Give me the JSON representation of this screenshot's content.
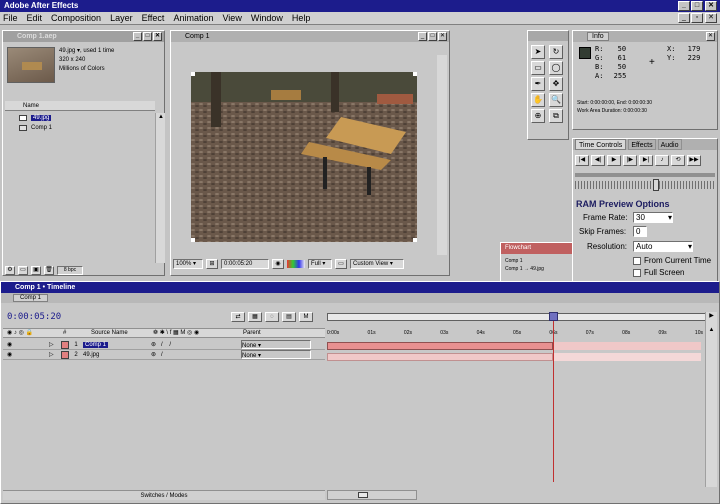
{
  "app": {
    "title": "Adobe After Effects",
    "menu": [
      "File",
      "Edit",
      "Composition",
      "Layer",
      "Effect",
      "Animation",
      "View",
      "Window",
      "Help"
    ]
  },
  "project": {
    "title": "Comp 1.aep",
    "thumb_info": [
      "49.jpg ▾, used 1 time",
      "320 x 240",
      "Millions of Colors"
    ],
    "column_header": "Name",
    "items": [
      {
        "name": "49.jpg",
        "selected": true
      },
      {
        "name": "Comp 1",
        "selected": false
      }
    ],
    "bit_depth": "8 bpc"
  },
  "comp": {
    "tab": "Comp 1",
    "zoom": "100%",
    "timecode": "0:00:05:20",
    "resolution": "Full",
    "view": "Custom View"
  },
  "info": {
    "tab": "Info",
    "r_label": "R:",
    "r": "50",
    "g_label": "G:",
    "g": "61",
    "b_label": "B:",
    "b": "50",
    "a_label": "A:",
    "a": "255",
    "x_label": "X:",
    "x": "179",
    "y_label": "Y:",
    "y": "229",
    "start": "Start: 0:00:00:00, End: 0:00:00:30",
    "work": "Work Area Duration: 0:00:00:30"
  },
  "time_controls": {
    "tabs": [
      "Time Controls",
      "Effects",
      "Audio"
    ],
    "ram_title": "RAM Preview Options",
    "frame_rate_label": "Frame Rate:",
    "frame_rate": "30",
    "skip_label": "Skip Frames:",
    "skip": "0",
    "resolution_label": "Resolution:",
    "resolution": "Auto",
    "from_current": "From Current Time",
    "full_screen": "Full Screen"
  },
  "flowchart": {
    "tab": "Flowchart",
    "items": [
      "Comp 1",
      "Comp 1 → 49.jpg"
    ]
  },
  "timeline": {
    "title": "Comp 1 • Timeline",
    "tab": "Comp 1",
    "timecode": "0:00:05:20",
    "columns": [
      "#",
      "Source Name",
      "Parent"
    ],
    "layers": [
      {
        "num": "1",
        "name": "Comp 1",
        "parent": "None"
      },
      {
        "num": "2",
        "name": "49.jpg",
        "parent": "None"
      }
    ],
    "ruler": [
      "0:00s",
      "01s",
      "02s",
      "03s",
      "04s",
      "05s",
      "06s",
      "07s",
      "08s",
      "09s",
      "10s"
    ],
    "footer": "Switches / Modes",
    "colors": {
      "bar": "#e89090",
      "bar_light": "#f0c8c8",
      "accent": "#1c1c8c"
    }
  }
}
